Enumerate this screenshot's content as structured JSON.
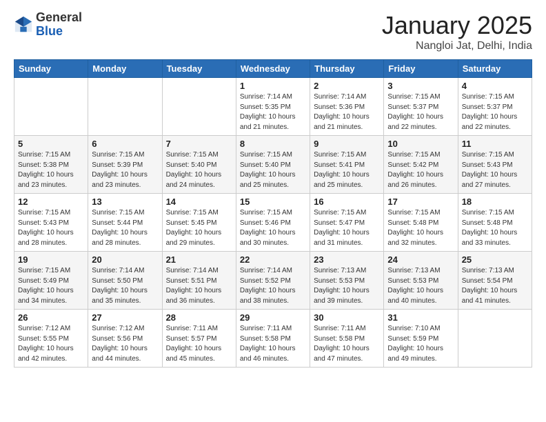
{
  "header": {
    "logo_general": "General",
    "logo_blue": "Blue",
    "title": "January 2025",
    "subtitle": "Nangloi Jat, Delhi, India"
  },
  "weekdays": [
    "Sunday",
    "Monday",
    "Tuesday",
    "Wednesday",
    "Thursday",
    "Friday",
    "Saturday"
  ],
  "weeks": [
    [
      {
        "day": "",
        "sunrise": "",
        "sunset": "",
        "daylight": ""
      },
      {
        "day": "",
        "sunrise": "",
        "sunset": "",
        "daylight": ""
      },
      {
        "day": "",
        "sunrise": "",
        "sunset": "",
        "daylight": ""
      },
      {
        "day": "1",
        "sunrise": "Sunrise: 7:14 AM",
        "sunset": "Sunset: 5:35 PM",
        "daylight": "Daylight: 10 hours and 21 minutes."
      },
      {
        "day": "2",
        "sunrise": "Sunrise: 7:14 AM",
        "sunset": "Sunset: 5:36 PM",
        "daylight": "Daylight: 10 hours and 21 minutes."
      },
      {
        "day": "3",
        "sunrise": "Sunrise: 7:15 AM",
        "sunset": "Sunset: 5:37 PM",
        "daylight": "Daylight: 10 hours and 22 minutes."
      },
      {
        "day": "4",
        "sunrise": "Sunrise: 7:15 AM",
        "sunset": "Sunset: 5:37 PM",
        "daylight": "Daylight: 10 hours and 22 minutes."
      }
    ],
    [
      {
        "day": "5",
        "sunrise": "Sunrise: 7:15 AM",
        "sunset": "Sunset: 5:38 PM",
        "daylight": "Daylight: 10 hours and 23 minutes."
      },
      {
        "day": "6",
        "sunrise": "Sunrise: 7:15 AM",
        "sunset": "Sunset: 5:39 PM",
        "daylight": "Daylight: 10 hours and 23 minutes."
      },
      {
        "day": "7",
        "sunrise": "Sunrise: 7:15 AM",
        "sunset": "Sunset: 5:40 PM",
        "daylight": "Daylight: 10 hours and 24 minutes."
      },
      {
        "day": "8",
        "sunrise": "Sunrise: 7:15 AM",
        "sunset": "Sunset: 5:40 PM",
        "daylight": "Daylight: 10 hours and 25 minutes."
      },
      {
        "day": "9",
        "sunrise": "Sunrise: 7:15 AM",
        "sunset": "Sunset: 5:41 PM",
        "daylight": "Daylight: 10 hours and 25 minutes."
      },
      {
        "day": "10",
        "sunrise": "Sunrise: 7:15 AM",
        "sunset": "Sunset: 5:42 PM",
        "daylight": "Daylight: 10 hours and 26 minutes."
      },
      {
        "day": "11",
        "sunrise": "Sunrise: 7:15 AM",
        "sunset": "Sunset: 5:43 PM",
        "daylight": "Daylight: 10 hours and 27 minutes."
      }
    ],
    [
      {
        "day": "12",
        "sunrise": "Sunrise: 7:15 AM",
        "sunset": "Sunset: 5:43 PM",
        "daylight": "Daylight: 10 hours and 28 minutes."
      },
      {
        "day": "13",
        "sunrise": "Sunrise: 7:15 AM",
        "sunset": "Sunset: 5:44 PM",
        "daylight": "Daylight: 10 hours and 28 minutes."
      },
      {
        "day": "14",
        "sunrise": "Sunrise: 7:15 AM",
        "sunset": "Sunset: 5:45 PM",
        "daylight": "Daylight: 10 hours and 29 minutes."
      },
      {
        "day": "15",
        "sunrise": "Sunrise: 7:15 AM",
        "sunset": "Sunset: 5:46 PM",
        "daylight": "Daylight: 10 hours and 30 minutes."
      },
      {
        "day": "16",
        "sunrise": "Sunrise: 7:15 AM",
        "sunset": "Sunset: 5:47 PM",
        "daylight": "Daylight: 10 hours and 31 minutes."
      },
      {
        "day": "17",
        "sunrise": "Sunrise: 7:15 AM",
        "sunset": "Sunset: 5:48 PM",
        "daylight": "Daylight: 10 hours and 32 minutes."
      },
      {
        "day": "18",
        "sunrise": "Sunrise: 7:15 AM",
        "sunset": "Sunset: 5:48 PM",
        "daylight": "Daylight: 10 hours and 33 minutes."
      }
    ],
    [
      {
        "day": "19",
        "sunrise": "Sunrise: 7:15 AM",
        "sunset": "Sunset: 5:49 PM",
        "daylight": "Daylight: 10 hours and 34 minutes."
      },
      {
        "day": "20",
        "sunrise": "Sunrise: 7:14 AM",
        "sunset": "Sunset: 5:50 PM",
        "daylight": "Daylight: 10 hours and 35 minutes."
      },
      {
        "day": "21",
        "sunrise": "Sunrise: 7:14 AM",
        "sunset": "Sunset: 5:51 PM",
        "daylight": "Daylight: 10 hours and 36 minutes."
      },
      {
        "day": "22",
        "sunrise": "Sunrise: 7:14 AM",
        "sunset": "Sunset: 5:52 PM",
        "daylight": "Daylight: 10 hours and 38 minutes."
      },
      {
        "day": "23",
        "sunrise": "Sunrise: 7:13 AM",
        "sunset": "Sunset: 5:53 PM",
        "daylight": "Daylight: 10 hours and 39 minutes."
      },
      {
        "day": "24",
        "sunrise": "Sunrise: 7:13 AM",
        "sunset": "Sunset: 5:53 PM",
        "daylight": "Daylight: 10 hours and 40 minutes."
      },
      {
        "day": "25",
        "sunrise": "Sunrise: 7:13 AM",
        "sunset": "Sunset: 5:54 PM",
        "daylight": "Daylight: 10 hours and 41 minutes."
      }
    ],
    [
      {
        "day": "26",
        "sunrise": "Sunrise: 7:12 AM",
        "sunset": "Sunset: 5:55 PM",
        "daylight": "Daylight: 10 hours and 42 minutes."
      },
      {
        "day": "27",
        "sunrise": "Sunrise: 7:12 AM",
        "sunset": "Sunset: 5:56 PM",
        "daylight": "Daylight: 10 hours and 44 minutes."
      },
      {
        "day": "28",
        "sunrise": "Sunrise: 7:11 AM",
        "sunset": "Sunset: 5:57 PM",
        "daylight": "Daylight: 10 hours and 45 minutes."
      },
      {
        "day": "29",
        "sunrise": "Sunrise: 7:11 AM",
        "sunset": "Sunset: 5:58 PM",
        "daylight": "Daylight: 10 hours and 46 minutes."
      },
      {
        "day": "30",
        "sunrise": "Sunrise: 7:11 AM",
        "sunset": "Sunset: 5:58 PM",
        "daylight": "Daylight: 10 hours and 47 minutes."
      },
      {
        "day": "31",
        "sunrise": "Sunrise: 7:10 AM",
        "sunset": "Sunset: 5:59 PM",
        "daylight": "Daylight: 10 hours and 49 minutes."
      },
      {
        "day": "",
        "sunrise": "",
        "sunset": "",
        "daylight": ""
      }
    ]
  ]
}
